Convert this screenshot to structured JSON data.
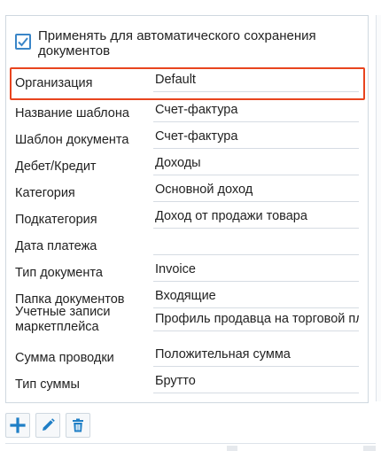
{
  "auto_save_checkbox": {
    "checked": true,
    "label": "Применять для автоматического сохранения документов"
  },
  "fields": [
    {
      "label": "Организация",
      "value": "Default"
    },
    {
      "label": "Название шаблона",
      "value": "Счет-фактура"
    },
    {
      "label": "Шаблон документа",
      "value": "Счет-фактура"
    },
    {
      "label": "Дебет/Кредит",
      "value": "Доходы"
    },
    {
      "label": "Категория",
      "value": "Основной доход"
    },
    {
      "label": "Подкатегория",
      "value": "Доход от продажи товара"
    },
    {
      "label": "Дата платежа",
      "value": ""
    },
    {
      "label": "Тип документа",
      "value": "Invoice"
    },
    {
      "label": "Папка документов",
      "value": "Входящие"
    },
    {
      "label": "Учетные записи маркетплейса",
      "value": "Профиль продавца на торговой пл"
    },
    {
      "label": "Сумма проводки",
      "value": "Положительная сумма"
    },
    {
      "label": "Тип суммы",
      "value": "Брутто"
    }
  ],
  "highlight_color": "#e8441e",
  "accent_color": "#1f7fc6",
  "toolbar": {
    "add_icon": "plus-icon",
    "edit_icon": "pencil-icon",
    "delete_icon": "trash-icon"
  }
}
